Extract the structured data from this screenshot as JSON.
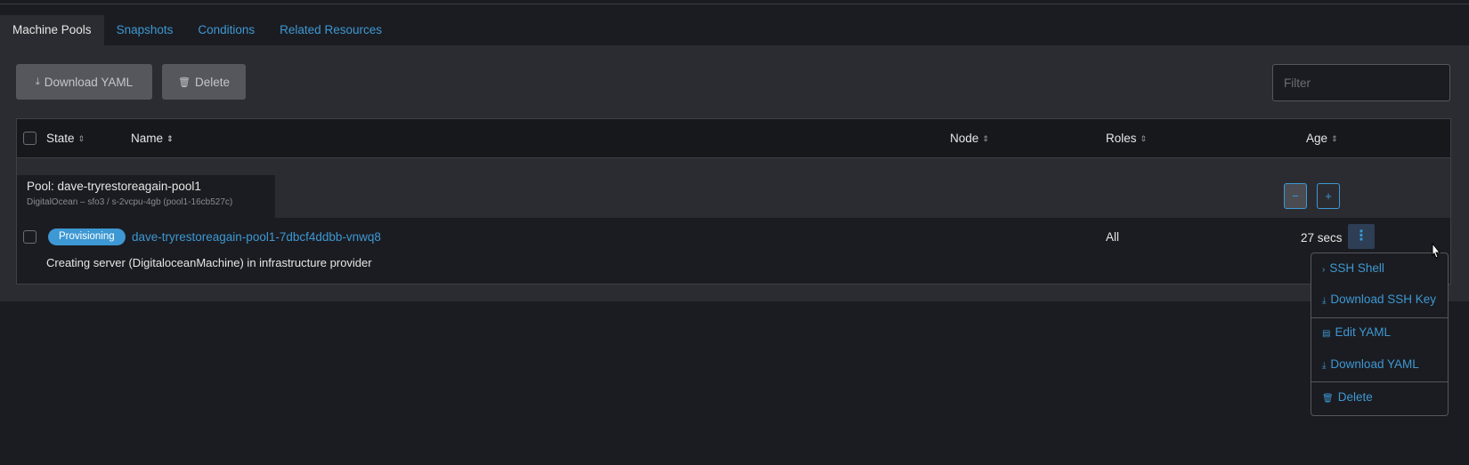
{
  "tabs": [
    {
      "label": "Machine Pools",
      "active": true
    },
    {
      "label": "Snapshots"
    },
    {
      "label": "Conditions"
    },
    {
      "label": "Related Resources"
    }
  ],
  "toolbar": {
    "download_yaml_label": "Download YAML",
    "delete_label": "Delete",
    "filter_placeholder": "Filter"
  },
  "table": {
    "headers": {
      "state": "State",
      "name": "Name",
      "node": "Node",
      "roles": "Roles",
      "age": "Age"
    },
    "group": {
      "title": "Pool: dave-tryrestoreagain-pool1",
      "subtitle": "DigitalOcean – sfo3 / s-2vcpu-4gb (pool1-16cb527c)",
      "scale_down": "−",
      "scale_up": "+"
    },
    "rows": [
      {
        "state": "Provisioning",
        "name": "dave-tryrestoreagain-pool1-7dbcf4ddbb-vnwq8",
        "node": "",
        "roles": "All",
        "age": "27 secs",
        "message": "Creating server (DigitaloceanMachine) in infrastructure provider"
      }
    ]
  },
  "action_menu": {
    "items": [
      {
        "label": "SSH Shell",
        "icon": "chevron-right-icon"
      },
      {
        "label": "Download SSH Key",
        "icon": "download-icon"
      },
      {
        "label": "Edit YAML",
        "icon": "file-icon"
      },
      {
        "label": "Download YAML",
        "icon": "download-icon"
      },
      {
        "label": "Delete",
        "icon": "trash-icon"
      }
    ]
  },
  "colors": {
    "accent": "#3d98d3",
    "background": "#1b1c21",
    "panel": "#2b2c31"
  }
}
